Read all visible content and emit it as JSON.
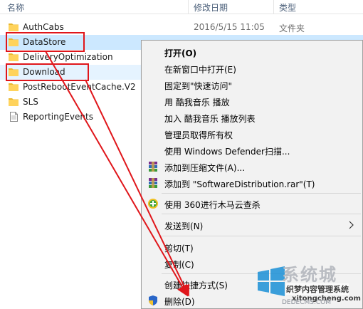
{
  "columns": {
    "name": "名称",
    "date": "修改日期",
    "type": "类型"
  },
  "rows": [
    {
      "name": "AuthCabs",
      "date": "2016/5/15 11:05",
      "type": "文件夹",
      "icon": "folder-icon"
    },
    {
      "name": "DataStore",
      "date": "",
      "type": "",
      "icon": "folder-icon"
    },
    {
      "name": "DeliveryOptimization",
      "date": "",
      "type": "",
      "icon": "folder-icon"
    },
    {
      "name": "Download",
      "date": "",
      "type": "",
      "icon": "folder-icon"
    },
    {
      "name": "PostRebootEventCache.V2",
      "date": "",
      "type": "",
      "icon": "folder-icon"
    },
    {
      "name": "SLS",
      "date": "",
      "type": "",
      "icon": "folder-icon"
    },
    {
      "name": "ReportingEvents",
      "date": "",
      "type": "",
      "icon": "file-icon"
    }
  ],
  "menu": {
    "open": "打开(O)",
    "open_new_window": "在新窗口中打开(E)",
    "pin_quick_access": "固定到\"快速访问\"",
    "play_kugou": "用 酷我音乐 播放",
    "add_kugou_list": "加入 酷我音乐 播放列表",
    "take_ownership": "管理员取得所有权",
    "defender_scan": "使用 Windows Defender扫描...",
    "add_archive": "添加到压缩文件(A)...",
    "add_rar": "添加到 \"SoftwareDistribution.rar\"(T)",
    "scan_360": "使用 360进行木马云查杀",
    "send_to": "发送到(N)",
    "cut": "剪切(T)",
    "copy": "复制(C)",
    "create_shortcut": "创建快捷方式(S)",
    "delete": "删除(D)"
  },
  "watermark": {
    "big": "系统城",
    "cn": "织梦内容管理系统",
    "en": "xitongcheng.com",
    "url": "DEDECMS.COM"
  },
  "colors": {
    "annotation_red": "#e0161b",
    "selection": "#cce8ff",
    "folder": "#ffd35c"
  }
}
